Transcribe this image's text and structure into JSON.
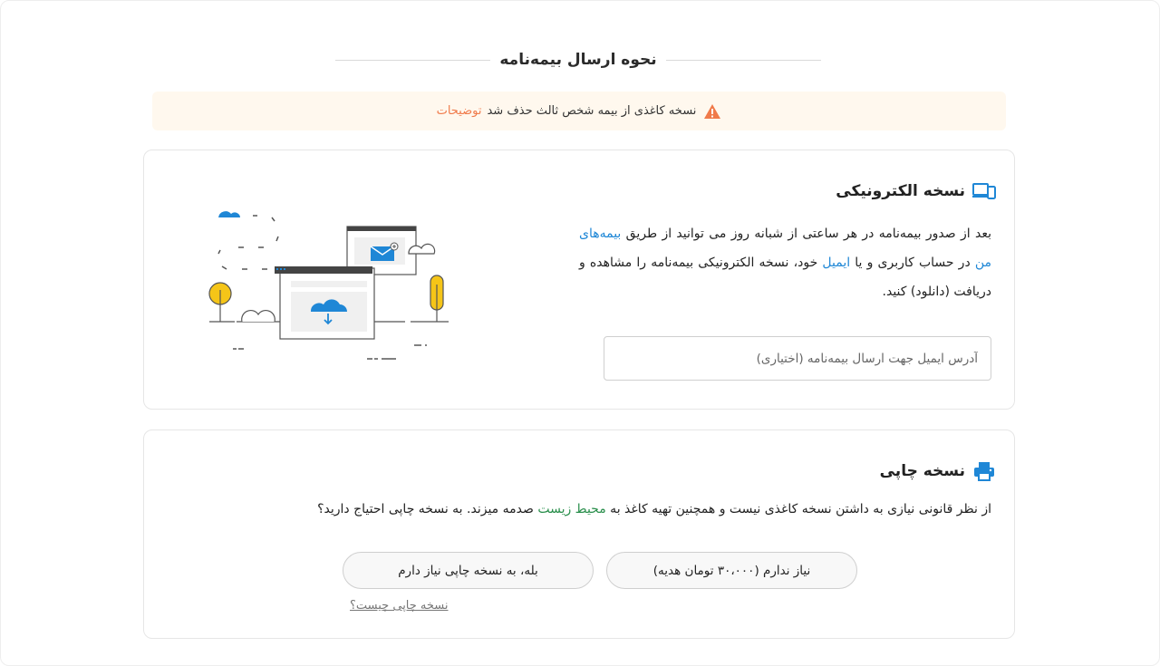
{
  "page": {
    "title": "نحوه ارسال بیمه‌نامه"
  },
  "alert": {
    "icon": "warning-triangle-icon",
    "text": "نسخه کاغذی از بیمه شخص ثالث حذف شد",
    "link": "توضیحات",
    "bg_color": "#fff8ee",
    "link_color": "#f07a4a"
  },
  "electronic": {
    "icon": "devices-icon",
    "title": "نسخه الکترونیکی",
    "desc_part1": "بعد از صدور بیمه‌نامه در هر ساعتی از شبانه روز می توانید از طریق ",
    "link_my_policies": "بیمه‌های من",
    "desc_part2": " در حساب کاربری و یا ",
    "link_email": "ایمیل",
    "desc_part3": " خود، نسخه الکترونیکی بیمه‌نامه را مشاهده و دریافت (دانلود) کنید.",
    "email_placeholder": "آدرس ایمیل جهت ارسال بیمه‌نامه (اختیاری)",
    "email_value": "",
    "accent_color": "#1f87d6"
  },
  "print": {
    "icon": "printer-icon",
    "title": "نسخه چاپی",
    "desc_part1": "از نظر قانونی نیازی به داشتن نسخه کاغذی نیست و همچنین تهیه کاغذ به ",
    "link_env": "محیط زیست",
    "desc_part2": " صدمه میزند. به نسخه چاپی احتیاج دارید؟",
    "btn_no": "نیاز ندارم (۳۰،۰۰۰ تومان هدیه)",
    "btn_yes": "بله، به نسخه چاپی نیاز دارم",
    "what_link": "نسخه چاپی چیست؟",
    "env_color": "#2a8f4c"
  }
}
